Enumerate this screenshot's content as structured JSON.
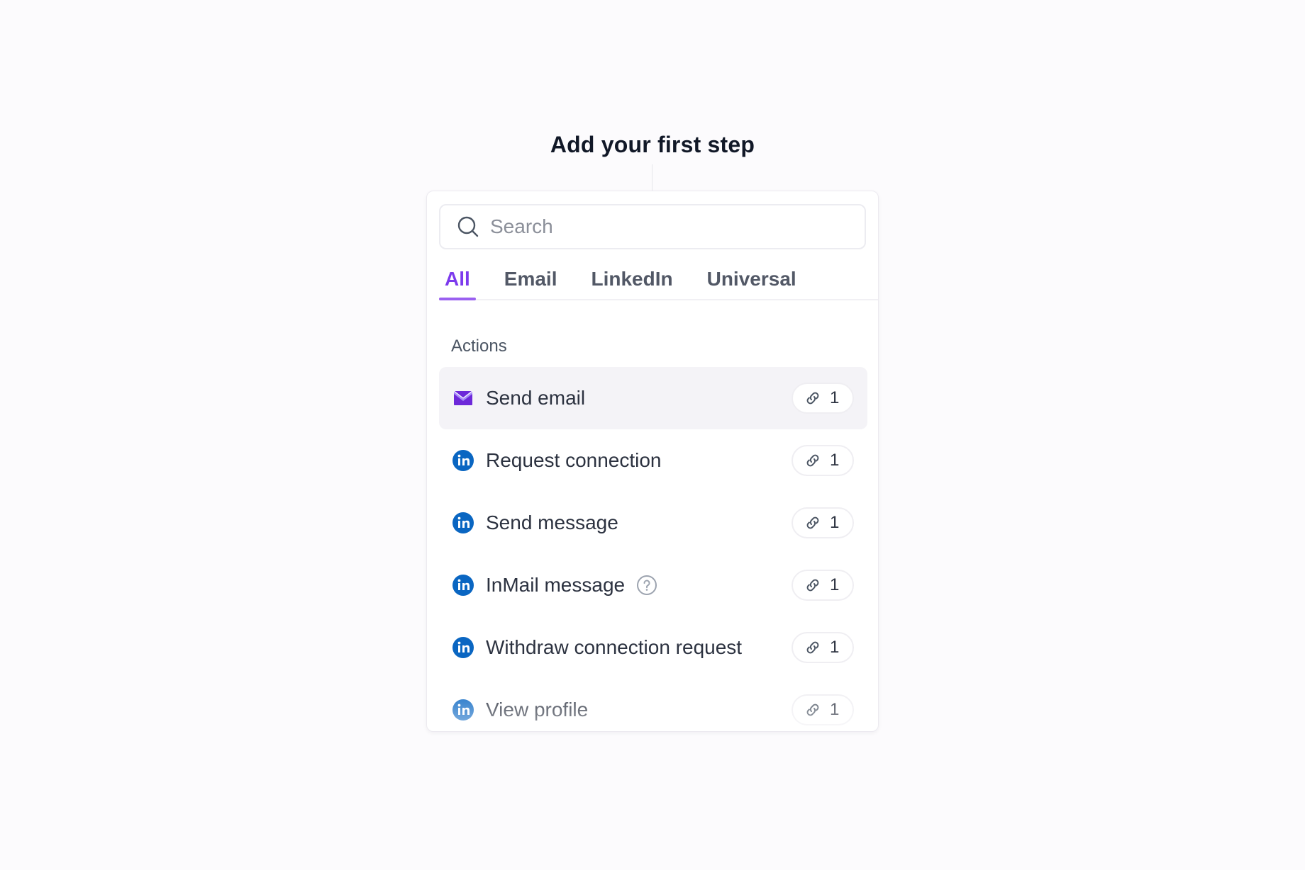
{
  "page": {
    "title": "Add your first step"
  },
  "search": {
    "placeholder": "Search"
  },
  "tabs": [
    {
      "label": "All",
      "active": true
    },
    {
      "label": "Email",
      "active": false
    },
    {
      "label": "LinkedIn",
      "active": false
    },
    {
      "label": "Universal",
      "active": false
    }
  ],
  "sections": {
    "actions": {
      "label": "Actions",
      "items": [
        {
          "label": "Send email",
          "icon": "email-icon",
          "count": "1",
          "selected": true
        },
        {
          "label": "Request connection",
          "icon": "linkedin-icon",
          "count": "1"
        },
        {
          "label": "Send message",
          "icon": "linkedin-icon",
          "count": "1"
        },
        {
          "label": "InMail message",
          "icon": "linkedin-icon",
          "count": "1",
          "help_icon": "question-circle-icon"
        },
        {
          "label": "Withdraw connection request",
          "icon": "linkedin-icon",
          "count": "1"
        },
        {
          "label": "View profile",
          "icon": "linkedin-icon",
          "count": "1"
        }
      ]
    }
  },
  "badge_icon": "link-icon",
  "colors": {
    "accent": "#7c3aed",
    "linkedin": "#0a66c2",
    "email": "#7c3aed"
  }
}
